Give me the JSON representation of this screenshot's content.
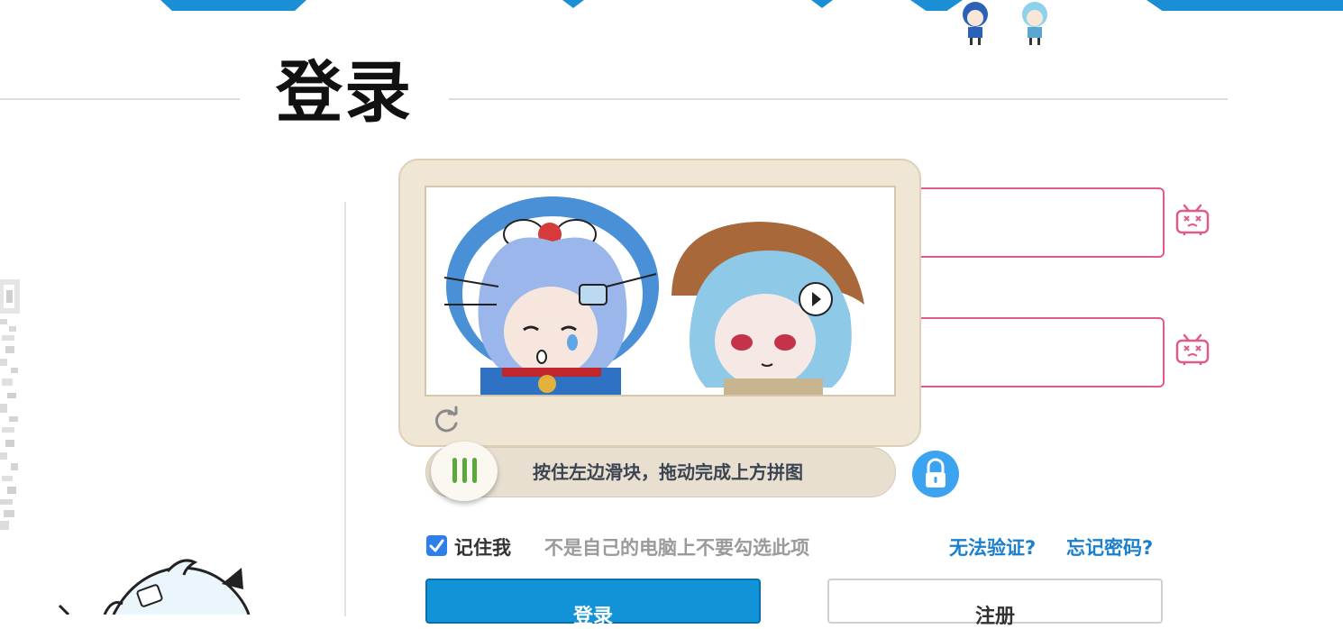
{
  "page": {
    "title": "登录"
  },
  "captcha": {
    "slider_hint": "按住左边滑块，拖动完成上方拼图"
  },
  "form": {
    "username_value": "",
    "password_value": "",
    "remember_label": "记住我",
    "remember_checked": true,
    "remember_hint": "不是自己的电脑上不要勾选此项",
    "cant_verify_link": "无法验证?",
    "forgot_password_link": "忘记密码?",
    "login_button": "登录",
    "register_button": "注册"
  },
  "colors": {
    "accent_blue": "#1293d8",
    "input_border_pink": "#e05b8a",
    "link_blue": "#1a7fce",
    "checkbox_blue": "#2f7fe8",
    "captcha_bg": "#efe6d6"
  },
  "icons": {
    "refresh": "refresh-icon",
    "lock": "lock-icon",
    "tv": "bilibili-tv-icon",
    "slider_handle": "grip-icon"
  }
}
